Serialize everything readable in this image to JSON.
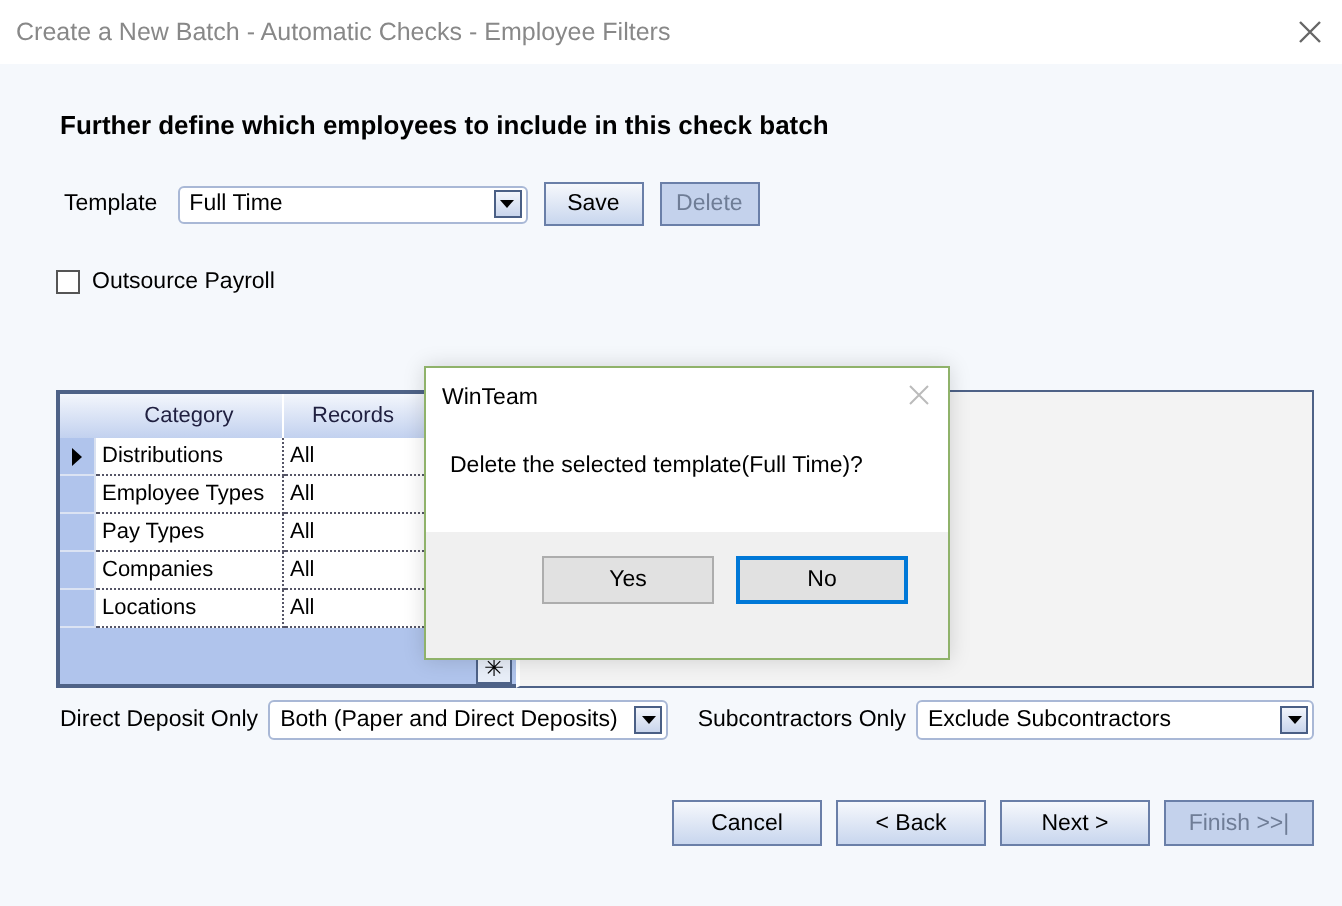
{
  "window": {
    "title": "Create a New Batch - Automatic Checks - Employee Filters"
  },
  "heading": "Further define which employees to include in this check batch",
  "template": {
    "label": "Template",
    "value": "Full Time",
    "buttons": [
      {
        "label": "Save",
        "disabled": false
      },
      {
        "label": "Delete",
        "disabled": true
      }
    ]
  },
  "outsource_payroll": {
    "label": "Outsource Payroll",
    "checked": false
  },
  "grid": {
    "columns": [
      "Category",
      "Records"
    ],
    "rows": [
      {
        "category": "Distributions",
        "records": "All",
        "selected": true
      },
      {
        "category": "Employee Types",
        "records": "All",
        "selected": false
      },
      {
        "category": "Pay Types",
        "records": "All",
        "selected": false
      },
      {
        "category": "Companies",
        "records": "All",
        "selected": false
      },
      {
        "category": "Locations",
        "records": "All",
        "selected": false
      }
    ],
    "new_row_button": "✳"
  },
  "filters": [
    {
      "label": "Direct Deposit Only",
      "value": "Both (Paper and Direct Deposits)"
    },
    {
      "label": "Subcontractors Only",
      "value": "Exclude Subcontractors"
    }
  ],
  "nav_buttons": [
    {
      "label": "Cancel",
      "disabled": false
    },
    {
      "label": "< Back",
      "disabled": false
    },
    {
      "label": "Next >",
      "disabled": false
    },
    {
      "label": "Finish >>|",
      "disabled": true
    }
  ],
  "dialog": {
    "title": "WinTeam",
    "message": "Delete the selected template(Full Time)?",
    "buttons": [
      {
        "label": "Yes",
        "selected": false
      },
      {
        "label": "No",
        "selected": true
      }
    ]
  }
}
